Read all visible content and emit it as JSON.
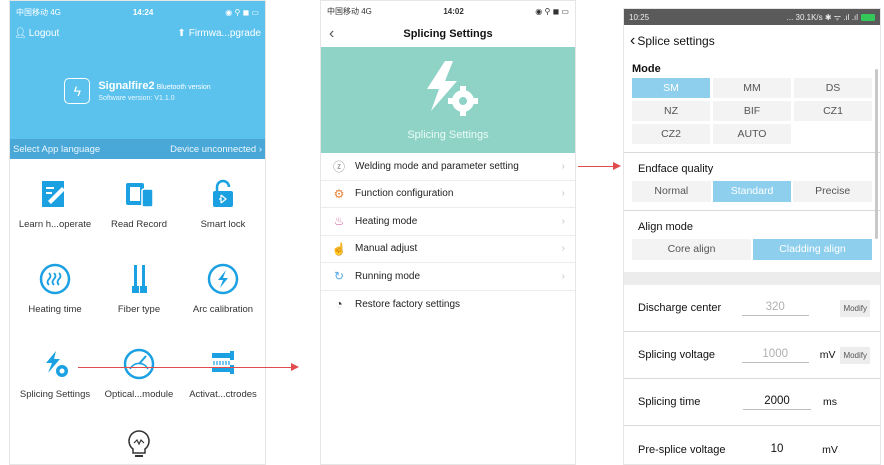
{
  "phone1": {
    "status": {
      "carrier": "中国移动 4G",
      "time": "14:24",
      "icons": "◉ ⚲ ◼ ▭"
    },
    "nav": {
      "logout": "Logout",
      "firmware": "Firmwa...pgrade"
    },
    "brand": {
      "name": "Signalfire2",
      "tag": "Bluetooth version",
      "version": "Software version: V1.1.0"
    },
    "langbar": {
      "language": "Select App language",
      "device": "Device unconnected"
    },
    "tiles": [
      {
        "label": "Learn h...operate",
        "icon": "edit-note-icon"
      },
      {
        "label": "Read Record",
        "icon": "devices-icon"
      },
      {
        "label": "Smart lock",
        "icon": "bluetooth-lock-icon"
      },
      {
        "label": "Heating time",
        "icon": "heating-timer-icon"
      },
      {
        "label": "Fiber type",
        "icon": "fiber-type-icon"
      },
      {
        "label": "Arc calibration",
        "icon": "arc-calibration-icon"
      },
      {
        "label": "Splicing Settings",
        "icon": "splicing-settings-icon"
      },
      {
        "label": "Optical...module",
        "icon": "gauge-icon"
      },
      {
        "label": "Activat...ctrodes",
        "icon": "electrode-icon"
      },
      {
        "label": "",
        "icon": "bulb-icon"
      }
    ]
  },
  "phone2": {
    "status": {
      "carrier": "中国移动 4G",
      "time": "14:02",
      "icons": "◉ ⚲ ◼ ▭"
    },
    "title": "Splicing Settings",
    "hero_text": "Splicing Settings",
    "menu": [
      {
        "label": "Welding mode and parameter setting",
        "icon": "lightning-circle-icon",
        "color": "#888888"
      },
      {
        "label": "Function configuration",
        "icon": "gear-icon",
        "color": "#e8823a"
      },
      {
        "label": "Heating mode",
        "icon": "heater-icon",
        "color": "#d46aa5"
      },
      {
        "label": "Manual adjust",
        "icon": "hand-icon",
        "color": "#e8a23a"
      },
      {
        "label": "Running mode",
        "icon": "running-icon",
        "color": "#5aa9e6"
      },
      {
        "label": "Restore factory settings",
        "icon": "restore-icon",
        "color": "#333333"
      }
    ]
  },
  "phone3": {
    "status": {
      "time": "10:25",
      "right": "... 30.1K/s ✱ ᯤ .ıl .ıl"
    },
    "title": "Splice settings",
    "mode_label": "Mode",
    "modes": [
      "SM",
      "MM",
      "DS",
      "NZ",
      "BIF",
      "CZ1",
      "CZ2",
      "AUTO"
    ],
    "selected_mode": "SM",
    "endface": {
      "label": "Endface quality",
      "options": [
        "Normal",
        "Standard",
        "Precise"
      ],
      "selected": "Standard"
    },
    "align": {
      "label": "Align mode",
      "options": [
        "Core align",
        "Cladding align"
      ],
      "selected": "Cladding align"
    },
    "params": [
      {
        "label": "Discharge center",
        "value": "320",
        "unit": "",
        "modify": "Modify",
        "muted": true
      },
      {
        "label": "Splicing voltage",
        "value": "1000",
        "unit": "mV",
        "modify": "Modify",
        "muted": true
      },
      {
        "label": "Splicing time",
        "value": "2000",
        "unit": "ms",
        "modify": "",
        "muted": false
      },
      {
        "label": "Pre-splice voltage",
        "value": "10",
        "unit": "mV",
        "modify": "",
        "muted": false
      }
    ]
  },
  "colors": {
    "header_blue": "#5bc2ee",
    "accent_teal": "#8fd3c7",
    "selected_segment": "#8ecfee",
    "arrow": "#e14b4b"
  }
}
